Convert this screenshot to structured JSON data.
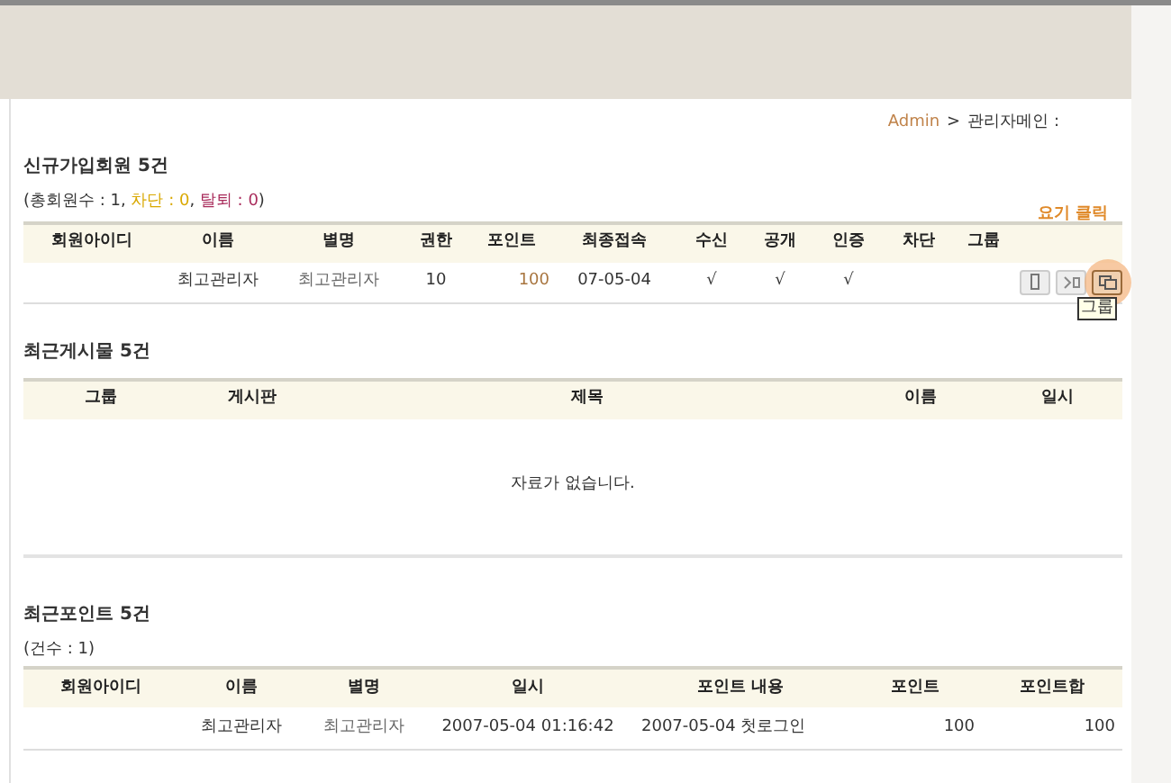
{
  "breadcrumb": {
    "link": "Admin",
    "separator": ">",
    "current": "관리자메인 :"
  },
  "members": {
    "title": "신규가입회원 5건",
    "summary": {
      "open": "(총회원수 : 1, ",
      "blocked": "차단 : 0",
      "comma": ", ",
      "left": "탈퇴 : 0",
      "close": ")"
    },
    "columns": [
      "회원아이디",
      "이름",
      "별명",
      "권한",
      "포인트",
      "최종접속",
      "수신",
      "공개",
      "인증",
      "차단",
      "그룹"
    ],
    "rows": [
      {
        "cells": [
          "",
          "최고관리자",
          "최고관리자",
          "10",
          "100",
          "07-05-04",
          "√",
          "√",
          "√",
          "",
          ""
        ],
        "buttons": [
          {
            "kind": "edit",
            "selected": false
          },
          {
            "kind": "move",
            "selected": false
          },
          {
            "kind": "group",
            "selected": true
          }
        ]
      }
    ],
    "callout": "요기 클릭",
    "tooltip": "그룹"
  },
  "posts": {
    "title": "최근게시물 5건",
    "columns": [
      "그룹",
      "게시판",
      "제목",
      "이름",
      "일시"
    ],
    "empty": "자료가 없습니다."
  },
  "points": {
    "title": "최근포인트 5건",
    "summary": "(건수 : 1)",
    "columns": [
      "회원아이디",
      "이름",
      "별명",
      "일시",
      "포인트 내용",
      "포인트",
      "포인트합"
    ],
    "rows": [
      [
        "",
        "최고관리자",
        "최고관리자",
        "2007-05-04 01:16:42",
        "2007-05-04 첫로그인",
        "100",
        "100"
      ]
    ]
  }
}
